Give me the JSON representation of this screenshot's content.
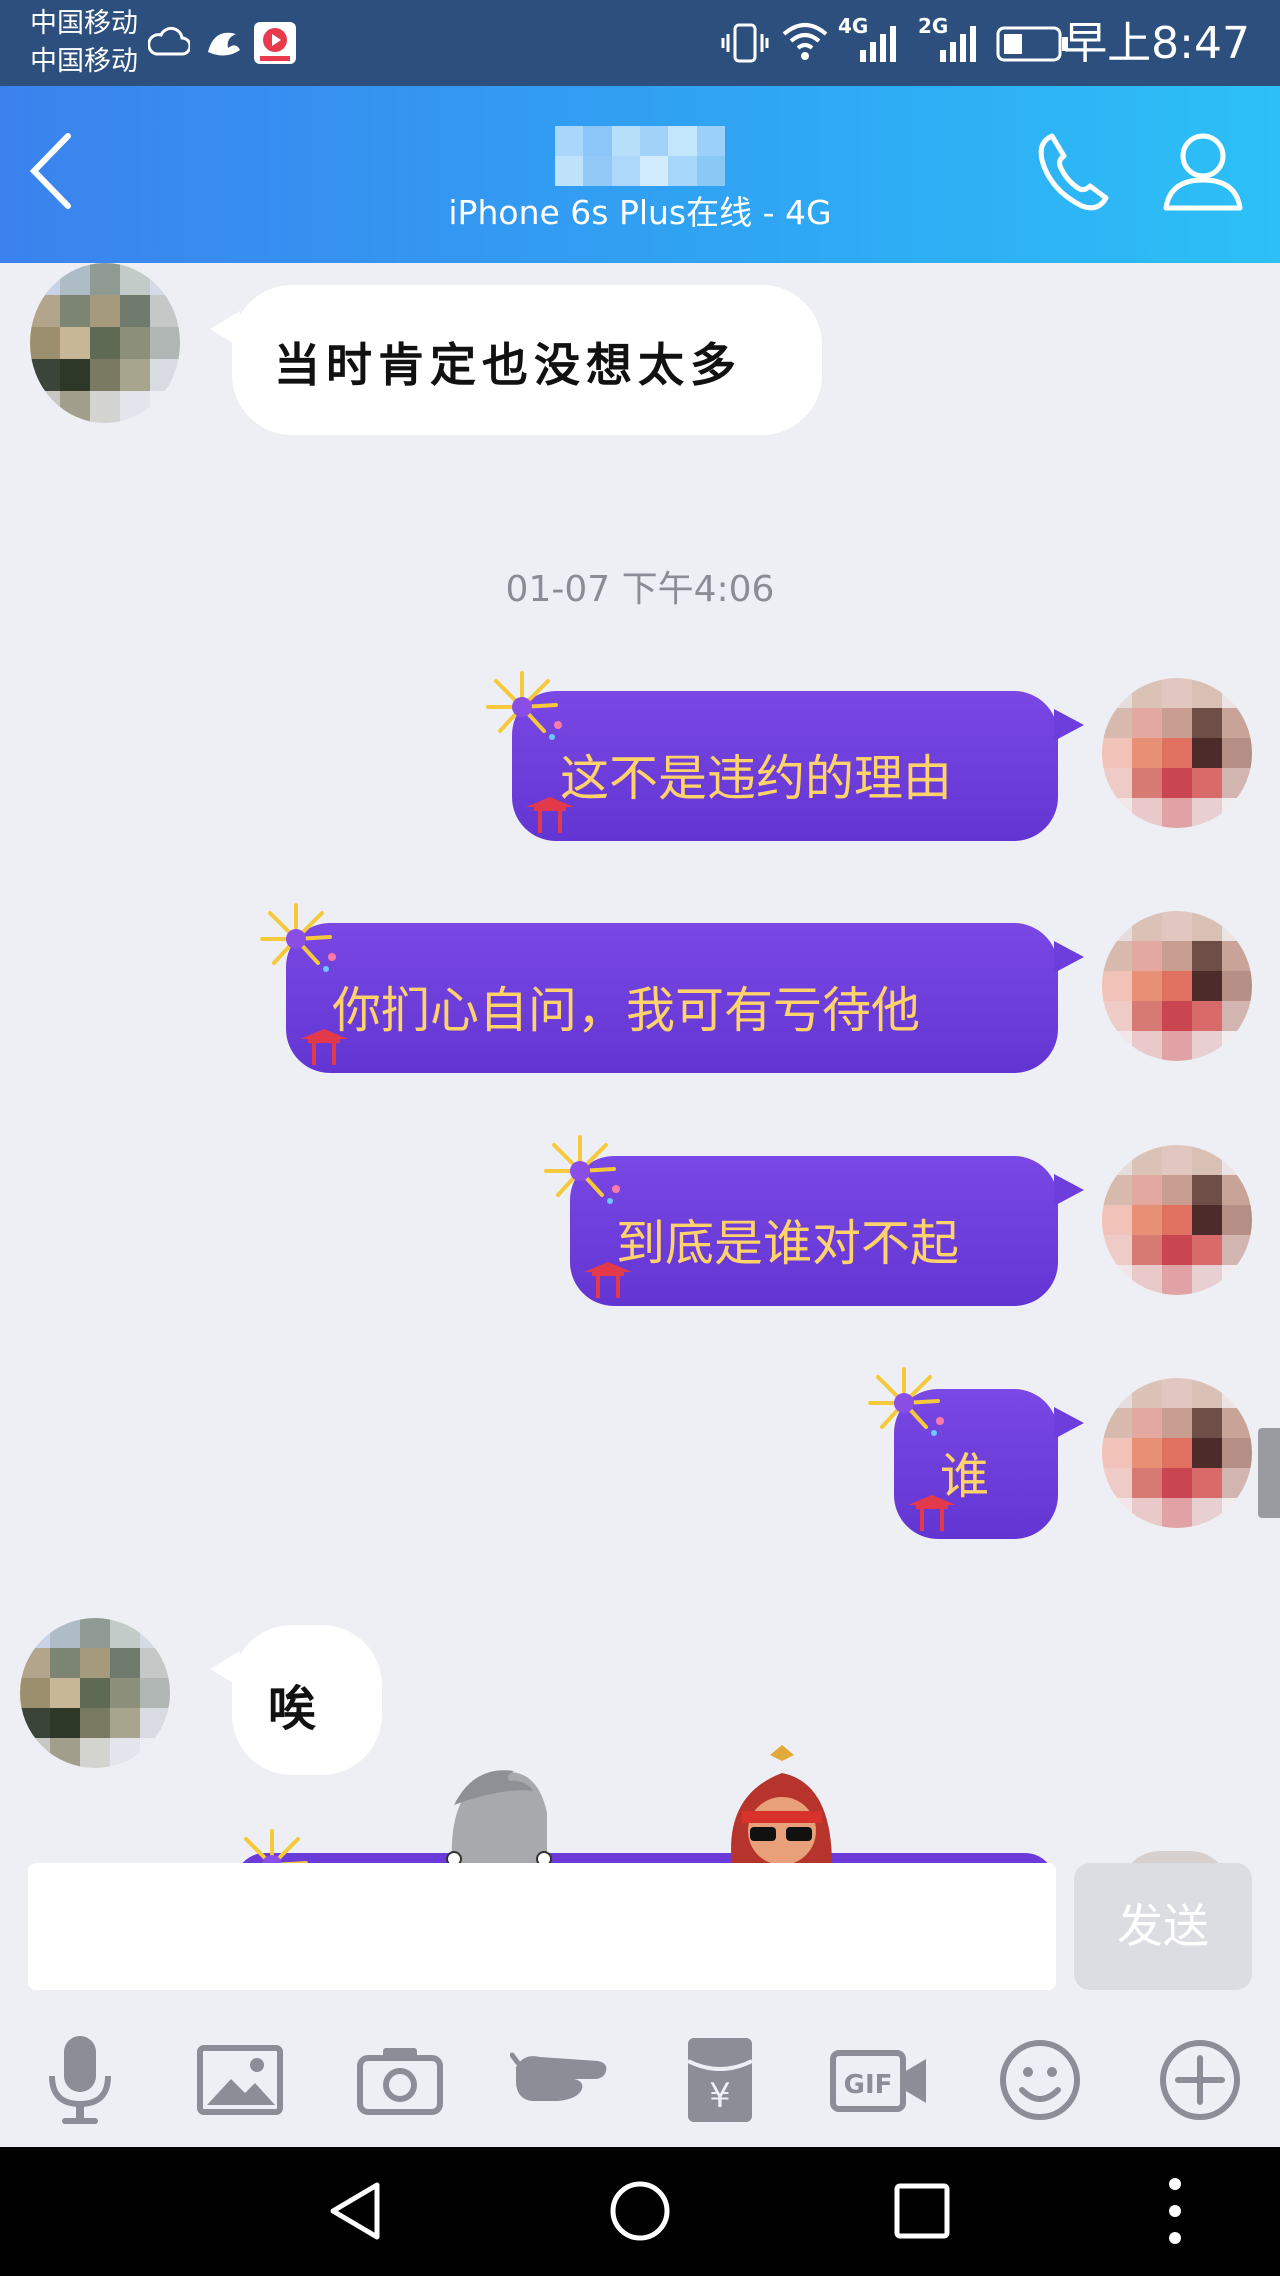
{
  "status_bar": {
    "carrier_1": "中国移动",
    "carrier_2": "中国移动",
    "network_1": "4G",
    "network_2": "2G",
    "clock": "早上8:47"
  },
  "header": {
    "back_icon": "chevron-left-icon",
    "contact_status": "iPhone 6s Plus在线 - 4G",
    "phone_icon": "phone-icon",
    "profile_icon": "person-icon"
  },
  "messages": [
    {
      "side": "left",
      "text": "当时肯定也没想太多"
    },
    {
      "side": "time",
      "text": "01-07 下午4:06"
    },
    {
      "side": "right",
      "text": "这不是违约的理由"
    },
    {
      "side": "right",
      "text": "你扪心自问，我可有亏待他"
    },
    {
      "side": "right",
      "text": "到底是谁对不起"
    },
    {
      "side": "right",
      "text": "谁"
    },
    {
      "side": "left",
      "text": "唉"
    }
  ],
  "composer": {
    "input_value": "",
    "send_label": "发送"
  },
  "toolbar": [
    "microphone-icon",
    "image-icon",
    "camera-icon",
    "poke-icon",
    "red-packet-icon",
    "gif-icon",
    "emoji-icon",
    "plus-icon"
  ],
  "colors": {
    "header_start": "#3b82ee",
    "header_end": "#2cc0f6",
    "bubble_purple": "#6d3edb",
    "bubble_text": "#ffd36a",
    "background": "#eeeff5"
  }
}
